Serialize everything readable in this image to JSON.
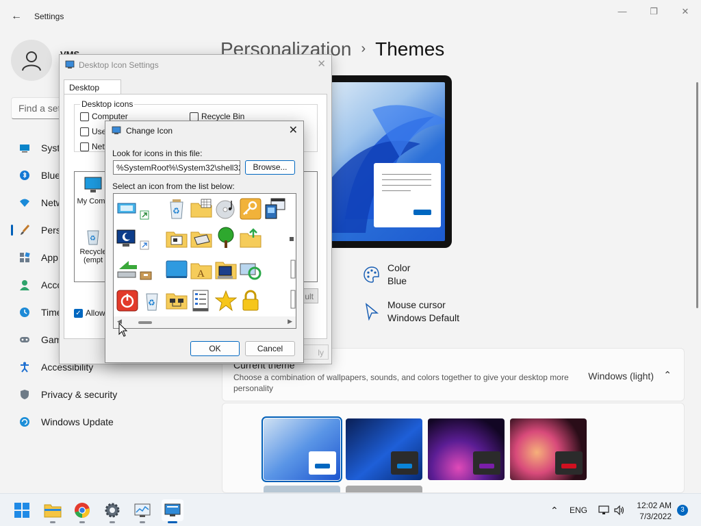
{
  "window": {
    "app_title": "Settings",
    "minimize_glyph": "—",
    "maximize_glyph": "❐",
    "close_glyph": "✕",
    "back_glyph": "←"
  },
  "user": {
    "name": "VMS"
  },
  "search": {
    "placeholder": "Find a setting"
  },
  "sidebar": {
    "items": [
      {
        "label": "System",
        "icon": "monitor-icon",
        "visible": "Syste"
      },
      {
        "label": "Bluetooth & devices",
        "icon": "bluetooth-icon",
        "visible": "Blue"
      },
      {
        "label": "Network & internet",
        "icon": "wifi-icon",
        "visible": "Netw"
      },
      {
        "label": "Personalization",
        "icon": "brush-icon",
        "visible": "Pers"
      },
      {
        "label": "Apps",
        "icon": "apps-icon",
        "visible": "App"
      },
      {
        "label": "Accounts",
        "icon": "person-icon",
        "visible": "Acco"
      },
      {
        "label": "Time & language",
        "icon": "clock-globe-icon",
        "visible": "Time"
      },
      {
        "label": "Gaming",
        "icon": "gamepad-icon",
        "visible": "Gam"
      },
      {
        "label": "Accessibility",
        "icon": "accessibility-icon",
        "visible": "Accessibility"
      },
      {
        "label": "Privacy & security",
        "icon": "shield-icon",
        "visible": "Privacy & security"
      },
      {
        "label": "Windows Update",
        "icon": "update-icon",
        "visible": "Windows Update"
      }
    ]
  },
  "breadcrumb": {
    "parent": "Personalization",
    "separator": "›",
    "current": "Themes"
  },
  "properties": {
    "color": {
      "title": "Color",
      "value": "Blue"
    },
    "cursor": {
      "title": "Mouse cursor",
      "value": "Windows Default"
    }
  },
  "current_theme": {
    "title": "Current theme",
    "description": "Choose a combination of wallpapers, sounds, and colors together to give your desktop more personality",
    "value": "Windows (light)",
    "chevron": "⌃"
  },
  "desktop_icon_settings": {
    "title": "Desktop Icon Settings",
    "close_glyph": "✕",
    "tab_label": "Desktop Icons",
    "group_label": "Desktop icons",
    "checkboxes": [
      {
        "label": "Computer",
        "checked": false
      },
      {
        "label": "User's Files",
        "checked": false,
        "visible": "User"
      },
      {
        "label": "Network",
        "checked": false,
        "visible": "Netw"
      },
      {
        "label": "Recycle Bin",
        "checked": false
      }
    ],
    "list_items": [
      {
        "label": "My Computer",
        "visible": "My Comp"
      },
      {
        "label": "Recycle Bin (empty)",
        "visible_line1": "Recycle",
        "visible_line2": "(empt"
      }
    ],
    "restore_default_visible": "ult",
    "allow_themes_label": "Allow themes to change desktop icons",
    "allow_themes_visible": "Allow t",
    "apply_visible": "ly"
  },
  "change_icon": {
    "title": "Change Icon",
    "close_glyph": "✕",
    "look_label": "Look for icons in this file:",
    "path_value": "%SystemRoot%\\System32\\shell32.dll",
    "browse_label": "Browse...",
    "select_label": "Select an icon from the list below:",
    "ok_label": "OK",
    "cancel_label": "Cancel",
    "icons": [
      "window-shortcut-icon",
      "recycle-bin-full-icon",
      "folder-grid-icon",
      "cd-music-icon",
      "key-icon",
      "window-settings-icon",
      "monitor-moon-icon",
      "folder-network-icon",
      "drive-folder-icon",
      "tree-icon",
      "folder-up-icon",
      "usb-arrow-icon",
      "desktop-blue-icon",
      "folder-font-icon",
      "computer-folder-icon",
      "sync-monitor-icon",
      "power-icon",
      "recycle-bin-icon",
      "network-folder-icon",
      "list-window-icon",
      "star-icon",
      "lock-icon"
    ]
  },
  "taskbar": {
    "apps": [
      "start-icon",
      "file-explorer-icon",
      "chrome-icon",
      "settings-gear-icon",
      "resource-monitor-icon",
      "desktop-icon-settings-icon"
    ],
    "tray_chevron": "⌃",
    "language": "ENG",
    "time": "12:02 AM",
    "date": "7/3/2022",
    "notification_count": "3"
  },
  "colors": {
    "accent": "#005fb8",
    "taskbar": "#eef2f6",
    "background": "#f3f3f3"
  }
}
